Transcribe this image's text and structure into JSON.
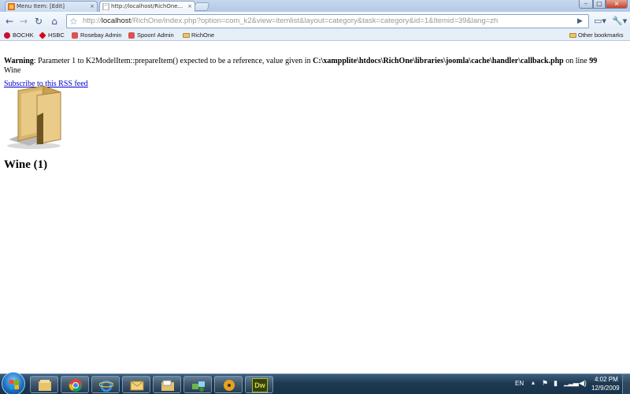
{
  "browser": {
    "tabs": [
      {
        "title": "Menu Item: [Edit]",
        "close": "×"
      },
      {
        "title": "http://localhost/RichOne...",
        "close": "×"
      }
    ],
    "window_controls": {
      "minimize": "–",
      "maximize": "□",
      "close": "×"
    },
    "nav": {
      "back": "←",
      "forward": "→",
      "reload": "↻",
      "home": "⌂",
      "go": "▶",
      "page_menu": "▭▾",
      "tools_menu": "🔧▾"
    },
    "address": {
      "scheme": "http://",
      "host": "localhost",
      "rest": "/RichOne/index.php?option=com_k2&view=itemlist&layout=category&task=category&id=1&Itemid=39&lang=zh",
      "star": "☆"
    },
    "bookmarks": [
      {
        "label": "BOCHK",
        "icon_color": "#c8102e"
      },
      {
        "label": "HSBC",
        "icon_color": "#db0011"
      },
      {
        "label": "Rosebay Admin",
        "icon_color": "#d9534f"
      },
      {
        "label": "Spoon!  Admin",
        "icon_color": "#d9534f"
      },
      {
        "label": "RichOne",
        "icon": "folder-icon"
      }
    ],
    "other_bookmarks": "Other bookmarks"
  },
  "page": {
    "warning_label": "Warning",
    "warning_text": ": Parameter 1 to K2ModelItem::prepareItem() expected to be a reference, value given in ",
    "warning_path": "C:\\xampplite\\htdocs\\RichOne\\libraries\\joomla\\cache\\handler\\callback.php",
    "warning_online": " on line ",
    "warning_line_number": "99",
    "category_name": "Wine",
    "rss_link": "Subscribe to this RSS feed",
    "category_title": "Wine (1)"
  },
  "taskbar": {
    "apps": [
      "explorer-icon",
      "chrome-icon",
      "ie-icon",
      "outlook-icon",
      "folder-icon",
      "network-icon",
      "media-icon",
      "dreamweaver-icon"
    ],
    "dreamweaver_label": "Dw",
    "language": "EN",
    "time": "4:02 PM",
    "date": "12/9/2009"
  }
}
